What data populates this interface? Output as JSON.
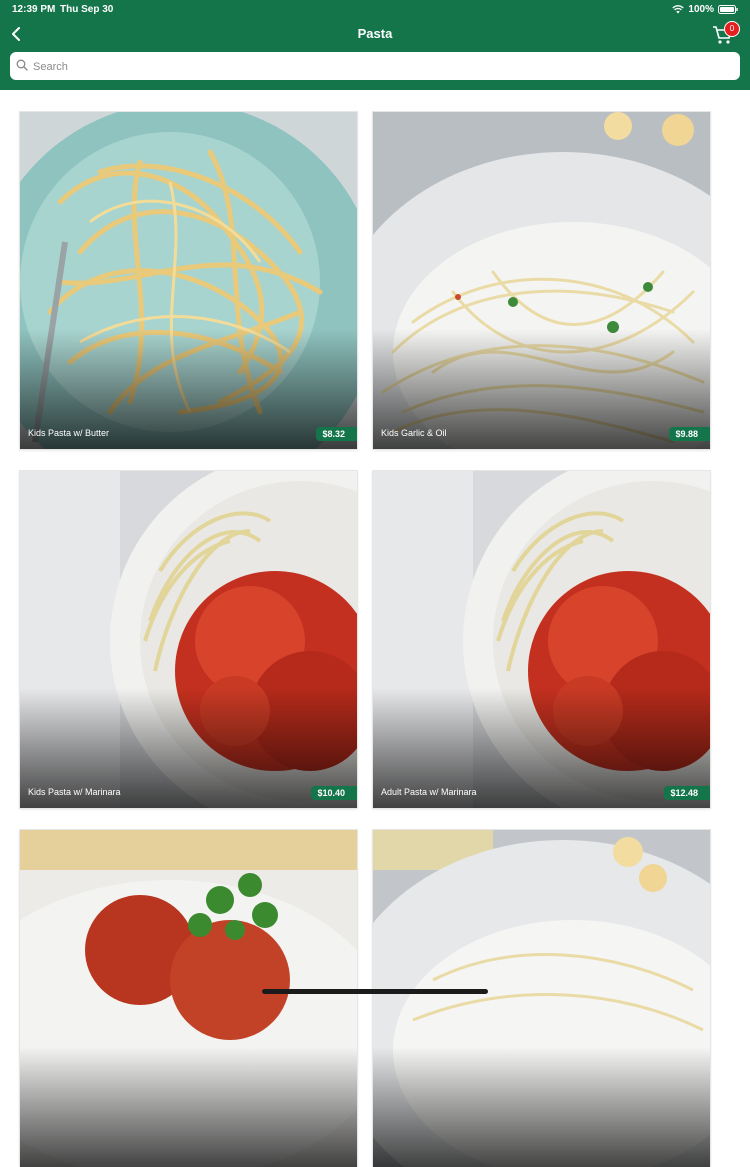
{
  "status_bar": {
    "time": "12:39 PM",
    "date": "Thu Sep 30",
    "battery": "100%"
  },
  "header": {
    "title": "Pasta",
    "cart_count": "0"
  },
  "search": {
    "placeholder": "Search"
  },
  "products": [
    {
      "name": "Kids Pasta w/ Butter",
      "price": "$8.32"
    },
    {
      "name": "Kids Garlic & Oil",
      "price": "$9.88"
    },
    {
      "name": "Kids Pasta w/ Marinara",
      "price": "$10.40"
    },
    {
      "name": "Adult Pasta w/ Marinara",
      "price": "$12.48"
    },
    {
      "name": "",
      "price": ""
    },
    {
      "name": "",
      "price": ""
    }
  ],
  "colors": {
    "brand": "#14744a",
    "badge": "#e51f1f"
  },
  "icons": [
    "back-chevron-icon",
    "cart-icon",
    "search-icon",
    "wifi-icon",
    "battery-icon"
  ]
}
